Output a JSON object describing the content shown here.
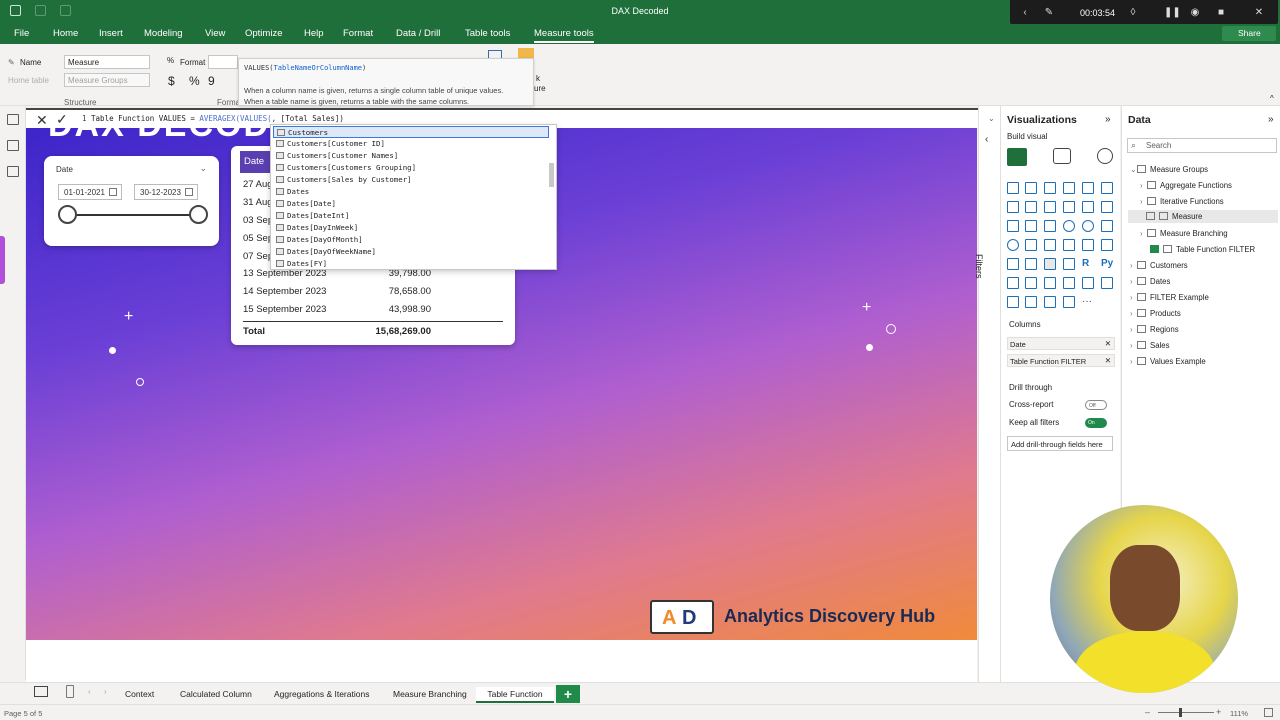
{
  "window": {
    "title": "DAX Decoded"
  },
  "recording": {
    "time": "00:03:54"
  },
  "menu": {
    "items": [
      "File",
      "Home",
      "Insert",
      "Modeling",
      "View",
      "Optimize",
      "Help",
      "Format",
      "Data / Drill",
      "Table tools",
      "Measure tools"
    ],
    "active": "Measure tools",
    "share": "Share"
  },
  "ribbon": {
    "name_label": "Name",
    "name_value": "Measure",
    "home_table_label": "Home table",
    "home_table_value": "Measure Groups",
    "format_label": "Format",
    "structure_label": "Structure",
    "formatting_label": "Formatt",
    "currency_symbol": "$",
    "percent_symbol": "%",
    "comma_symbol": "9",
    "new_measure_partial": "k",
    "quick_measure_partial": "ure"
  },
  "tooltip": {
    "func": "VALUES(",
    "param": "TableNameOrColumnName",
    "close": ")",
    "desc_line1": "When a column name is given, returns a single column table of unique values.",
    "desc_line2": "When a table name is given, returns a table with the same columns."
  },
  "formula": {
    "line_no": "1",
    "prefix": " Table Function VALUES = ",
    "fn1": "AVERAGEX(",
    "fn2": "VALUES(",
    "rest": ", [Total Sales])"
  },
  "autocomplete": {
    "items": [
      "Customers",
      "Customers[Customer ID]",
      "Customers[Customer Names]",
      "Customers[Customers Grouping]",
      "Customers[Sales by Customer]",
      "Dates",
      "Dates[Date]",
      "Dates[DateInt]",
      "Dates[DayInWeek]",
      "Dates[DayOfMonth]",
      "Dates[DayOfWeekName]",
      "Dates[FY]"
    ],
    "selected_index": 0
  },
  "canvas": {
    "big_title": "DAX DECODED",
    "slicer": {
      "label": "Date",
      "start": "01-01-2021",
      "end": "30-12-2023"
    },
    "table": {
      "header": "Date",
      "rows": [
        {
          "date": "27 Aug",
          "value": ""
        },
        {
          "date": "31 Aug",
          "value": ""
        },
        {
          "date": "03 Sep",
          "value": ""
        },
        {
          "date": "05 Sep",
          "value": ""
        },
        {
          "date": "07 Sep",
          "value": ""
        },
        {
          "date": "13 September 2023",
          "value": "39,798.00"
        },
        {
          "date": "14 September 2023",
          "value": "78,658.00"
        },
        {
          "date": "15 September 2023",
          "value": "43,998.90"
        }
      ],
      "total_label": "Total",
      "total_value": "15,68,269.00"
    },
    "brand": "Analytics Discovery Hub"
  },
  "filters": {
    "label": "Filters"
  },
  "visualizations": {
    "title": "Visualizations",
    "build_label": "Build visual",
    "columns_label": "Columns",
    "columns": [
      "Date",
      "Table Function FILTER"
    ],
    "drill_label": "Drill through",
    "cross_report": "Cross-report",
    "cross_state": "Off",
    "keep_filters": "Keep all filters",
    "keep_state": "On",
    "add_drill": "Add drill-through fields here"
  },
  "data_pane": {
    "title": "Data",
    "search_placeholder": "Search",
    "tree": [
      {
        "label": "Measure Groups",
        "level": 0,
        "expanded": true
      },
      {
        "label": "Aggregate Functions",
        "level": 1
      },
      {
        "label": "Iterative Functions",
        "level": 1
      },
      {
        "label": "Measure",
        "level": 2,
        "selected": true
      },
      {
        "label": "Measure Branching",
        "level": 1
      },
      {
        "label": "Table Function FILTER",
        "level": 2,
        "checked": true
      },
      {
        "label": "Customers",
        "level": 0
      },
      {
        "label": "Dates",
        "level": 0
      },
      {
        "label": "FILTER Example",
        "level": 0
      },
      {
        "label": "Products",
        "level": 0
      },
      {
        "label": "Regions",
        "level": 0
      },
      {
        "label": "Sales",
        "level": 0
      },
      {
        "label": "Values Example",
        "level": 0
      }
    ]
  },
  "page_tabs": {
    "tabs": [
      "Context",
      "Calculated Column",
      "Aggregations & Iterations",
      "Measure Branching",
      "Table Function"
    ],
    "active": "Table Function"
  },
  "status": {
    "page": "Page 5 of 5",
    "zoom": "111%"
  }
}
